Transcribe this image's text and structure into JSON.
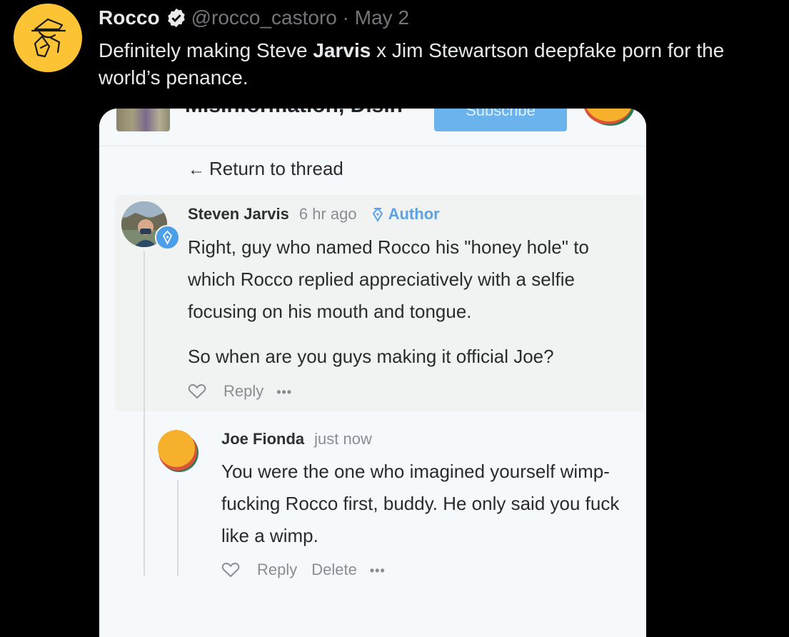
{
  "tweet": {
    "display_name": "Rocco",
    "handle": "@rocco_castoro",
    "separator": "·",
    "date": "May 2",
    "text_before": "Definitely making Steve ",
    "text_bold": "Jarvis",
    "text_after": " x Jim Stewartson deepfake porn for the world’s penance."
  },
  "screenshot": {
    "header_title_cut": "Misinformation, Disin",
    "subscribe_label": "Subscribe",
    "return_label": "Return to thread",
    "comments": [
      {
        "username": "Steven Jarvis",
        "time": "6 hr ago",
        "badge": "Author",
        "paragraphs": [
          "Right, guy who named Rocco his \"honey hole\" to which Rocco replied appreciatively with a selfie focusing on his mouth and tongue.",
          "So when are you guys making it official Joe?"
        ],
        "actions": [
          "Reply"
        ]
      },
      {
        "username": "Joe Fionda",
        "time": "just now",
        "paragraphs": [
          "You were the one who imagined yourself wimp-fucking Rocco first, buddy. He only said you fuck like a wimp."
        ],
        "actions": [
          "Reply",
          "Delete"
        ]
      }
    ],
    "more_label": "•••"
  },
  "colors": {
    "background": "#000000",
    "avatar_yellow": "#fcc334",
    "verified_blue": "#1d9bf0",
    "link_blue": "#5aa3e6",
    "subscribe_blue": "#6ab3ec"
  },
  "icons": [
    "detective-logo-icon",
    "verified-badge-icon",
    "left-arrow-icon",
    "pen-nib-icon",
    "heart-icon",
    "more-dots-icon"
  ]
}
